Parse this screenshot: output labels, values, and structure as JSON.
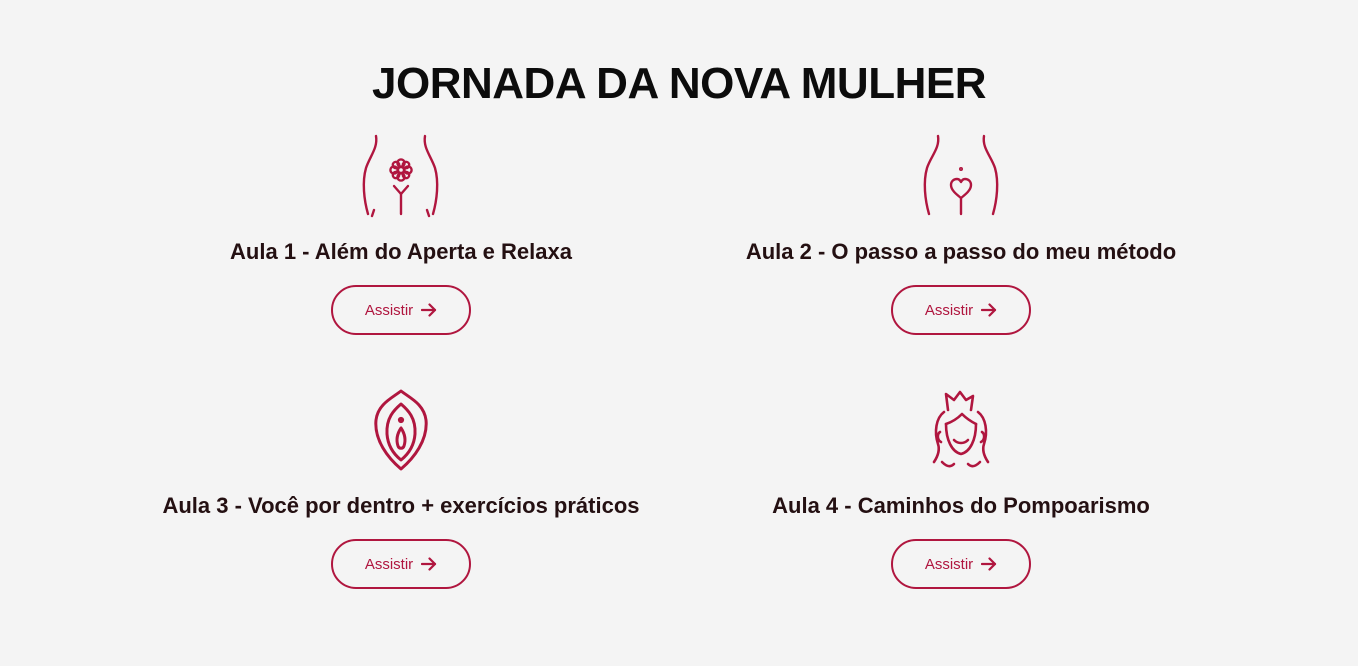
{
  "page": {
    "title": "JORNADA DA NOVA MULHER"
  },
  "theme": {
    "accent": "#b0163f",
    "background": "#f4f4f4",
    "text": "#241012"
  },
  "lessons": [
    {
      "title": "Aula 1 - Além do Aperta e Relaxa",
      "button_label": "Assistir",
      "icon": "body-flower-icon"
    },
    {
      "title": "Aula 2 - O passo a passo do meu método",
      "button_label": "Assistir",
      "icon": "body-heart-icon"
    },
    {
      "title": "Aula 3 - Você por dentro + exercícios práticos",
      "button_label": "Assistir",
      "icon": "vulva-icon"
    },
    {
      "title": "Aula 4 - Caminhos do Pompoarismo",
      "button_label": "Assistir",
      "icon": "woman-crown-icon"
    }
  ]
}
